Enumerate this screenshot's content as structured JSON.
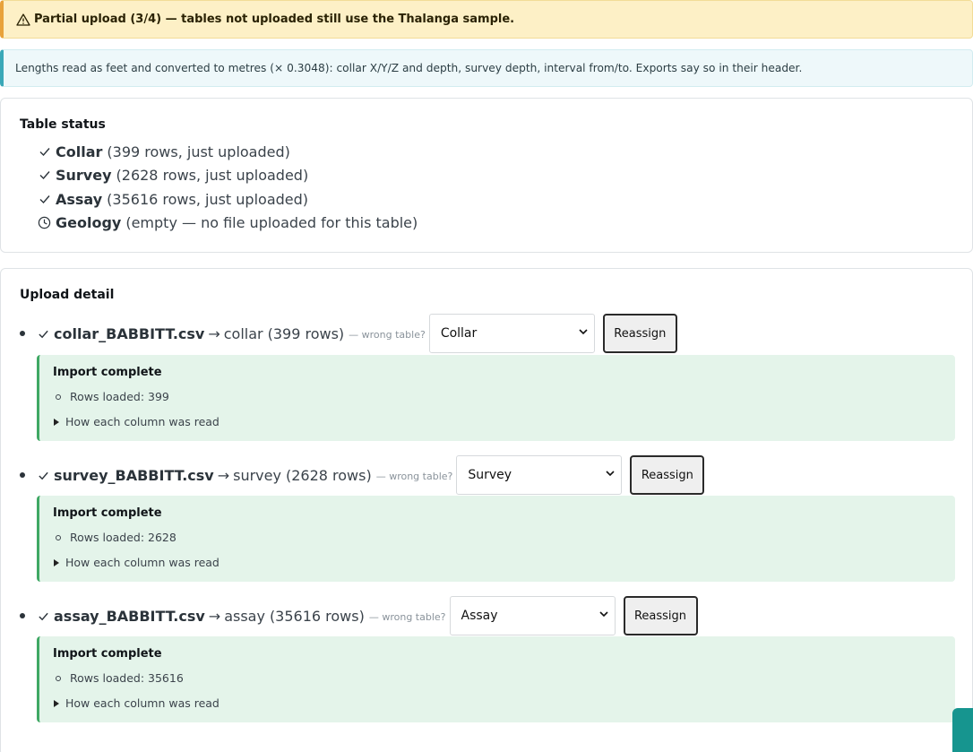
{
  "warning": {
    "icon": "warning-triangle-icon",
    "text": "Partial upload (3/4) — tables not uploaded still use the Thalanga sample."
  },
  "info": {
    "text": "Lengths read as feet and converted to metres (× 0.3048): collar X/Y/Z and depth, survey depth, interval from/to. Exports say so in their header."
  },
  "table_status": {
    "title": "Table status",
    "items": [
      {
        "icon": "check-icon",
        "name": "Collar",
        "detail": "(399 rows, just uploaded)"
      },
      {
        "icon": "check-icon",
        "name": "Survey",
        "detail": "(2628 rows, just uploaded)"
      },
      {
        "icon": "check-icon",
        "name": "Assay",
        "detail": "(35616 rows, just uploaded)"
      },
      {
        "icon": "clock-icon",
        "name": "Geology",
        "detail": "(empty — no file uploaded for this table)"
      }
    ]
  },
  "upload_detail": {
    "title": "Upload detail",
    "wrong_table_label": "— wrong table?",
    "reassign_label": "Reassign",
    "uploads": [
      {
        "file": "collar_BABBITT.csv",
        "arrow": "→",
        "table": "collar",
        "rows": "(399 rows)",
        "selected": "Collar",
        "result_title": "Import complete",
        "rows_loaded": "Rows loaded: 399",
        "details_label": "How each column was read"
      },
      {
        "file": "survey_BABBITT.csv",
        "arrow": "→",
        "table": "survey",
        "rows": "(2628 rows)",
        "selected": "Survey",
        "result_title": "Import complete",
        "rows_loaded": "Rows loaded: 2628",
        "details_label": "How each column was read"
      },
      {
        "file": "assay_BABBITT.csv",
        "arrow": "→",
        "table": "assay",
        "rows": "(35616 rows)",
        "selected": "Assay",
        "result_title": "Import complete",
        "rows_loaded": "Rows loaded: 35616",
        "details_label": "How each column was read"
      }
    ]
  },
  "colors": {
    "warning_bg": "#fdf0c6",
    "warning_accent": "#e8a23a",
    "info_bg": "#eef8fa",
    "info_accent": "#3aa8b8",
    "success_bg": "#e4f4ea",
    "success_accent": "#3fa864",
    "corner_tab": "#16958f"
  }
}
